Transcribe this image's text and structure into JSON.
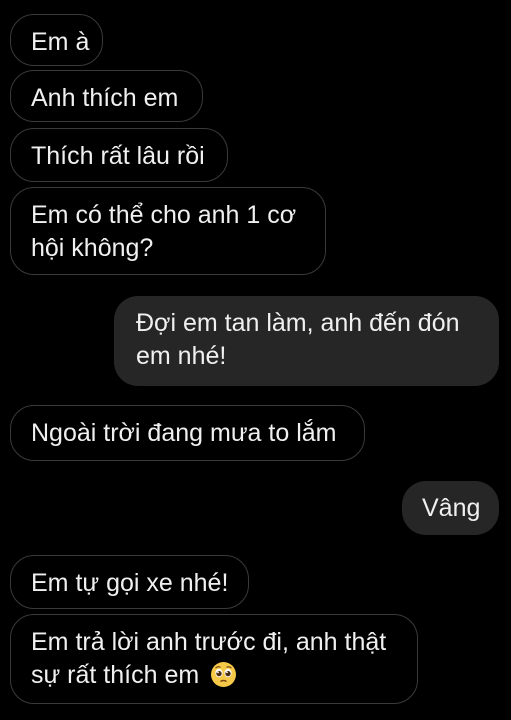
{
  "messages": [
    {
      "side": "incoming",
      "text": "Em à"
    },
    {
      "side": "incoming",
      "text": "Anh thích em"
    },
    {
      "side": "incoming",
      "text": "Thích rất lâu rồi"
    },
    {
      "side": "incoming",
      "line1": "Em có thể cho anh 1 cơ",
      "line2": "hội không?"
    },
    {
      "side": "outgoing",
      "line1": "Đợi em tan làm, anh đến đón",
      "line2": "em nhé!"
    },
    {
      "side": "incoming",
      "text": "Ngoài trời đang mưa to lắm"
    },
    {
      "side": "outgoing",
      "text": "Vâng"
    },
    {
      "side": "incoming",
      "text": "Em tự gọi xe nhé!"
    },
    {
      "side": "incoming",
      "line1": "Em trả lời anh trước đi, anh thật",
      "line2": "sự rất thích em",
      "emoji": "pleading-face-emoji"
    }
  ],
  "colors": {
    "background": "#000000",
    "incoming_border": "#3a3a3a",
    "outgoing_fill": "#262626",
    "text": "#f0f0f0"
  }
}
